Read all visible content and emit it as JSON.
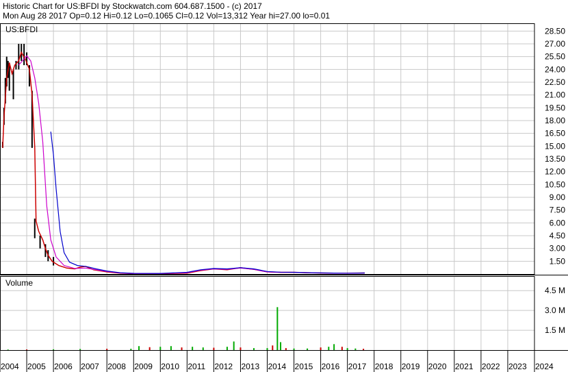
{
  "header": {
    "line1": "Historic Chart for US:BFDI by Stockwatch.com 604.687.1500 - (c) 2017",
    "line2": "Mon Aug 28 2017   Op=0.12  Hi=0.12  Lo=0.1065  Cl=0.12  Vol=13,312  Year hi=27.00  lo=0.01"
  },
  "chart_data": {
    "type": "line",
    "symbol_label": "US:BFDI",
    "volume_label": "Volume",
    "x_start_year": 2004.0,
    "x_end_year": 2024.0,
    "x_ticks": [
      "2004",
      "2005",
      "2006",
      "2007",
      "2008",
      "2009",
      "2010",
      "2011",
      "2012",
      "2013",
      "2014",
      "2015",
      "2016",
      "2017",
      "2018",
      "2019",
      "2020",
      "2021",
      "2022",
      "2023",
      "2024"
    ],
    "price_ylim": [
      0,
      29.25
    ],
    "price_ticks": [
      "1.50",
      "3.00",
      "4.50",
      "6.00",
      "7.50",
      "9.00",
      "10.50",
      "12.00",
      "13.50",
      "15.00",
      "16.50",
      "18.00",
      "19.50",
      "21.00",
      "22.50",
      "24.00",
      "25.50",
      "27.00",
      "28.50"
    ],
    "volume_ylim": [
      0,
      5.6
    ],
    "volume_ticks": [
      "1.5 M",
      "3.0 M",
      "4.5 M"
    ],
    "grid": true,
    "colors": {
      "price_hi_lo": "#000000",
      "price_down": "#cc0000",
      "ma_short": "#cc00cc",
      "ma_long": "#0000cc",
      "volume_up": "#00aa00",
      "volume_down": "#cc0000",
      "grid": "#c8c8c8"
    },
    "series": [
      {
        "name": "",
        "kind": "price_close",
        "points": [
          [
            2004.1,
            14.8
          ],
          [
            2004.15,
            18.5
          ],
          [
            2004.25,
            23.0
          ],
          [
            2004.35,
            24.8
          ],
          [
            2004.45,
            23.5
          ],
          [
            2004.55,
            24.5
          ],
          [
            2004.7,
            25.0
          ],
          [
            2004.8,
            26.0
          ],
          [
            2004.95,
            25.2
          ],
          [
            2005.1,
            24.0
          ],
          [
            2005.2,
            21.0
          ],
          [
            2005.3,
            14.8
          ],
          [
            2005.35,
            6.2
          ],
          [
            2005.45,
            5.0
          ],
          [
            2005.6,
            4.0
          ],
          [
            2005.7,
            3.0
          ],
          [
            2005.8,
            2.2
          ],
          [
            2005.95,
            1.5
          ],
          [
            2006.2,
            1.0
          ],
          [
            2006.5,
            0.7
          ],
          [
            2006.8,
            0.6
          ],
          [
            2007.0,
            0.8
          ],
          [
            2007.2,
            0.9
          ],
          [
            2007.5,
            0.5
          ],
          [
            2008.0,
            0.25
          ],
          [
            2008.5,
            0.1
          ],
          [
            2009.0,
            0.05
          ],
          [
            2010.0,
            0.05
          ],
          [
            2011.0,
            0.1
          ],
          [
            2011.5,
            0.4
          ],
          [
            2012.0,
            0.6
          ],
          [
            2012.5,
            0.5
          ],
          [
            2013.0,
            0.75
          ],
          [
            2013.5,
            0.55
          ],
          [
            2014.0,
            0.25
          ],
          [
            2014.5,
            0.2
          ],
          [
            2015.0,
            0.2
          ],
          [
            2015.5,
            0.15
          ],
          [
            2016.0,
            0.12
          ],
          [
            2016.5,
            0.1
          ],
          [
            2017.0,
            0.1
          ],
          [
            2017.65,
            0.12
          ]
        ]
      },
      {
        "name": "",
        "kind": "moving_average_short",
        "points": [
          [
            2004.7,
            24.5
          ],
          [
            2005.0,
            25.6
          ],
          [
            2005.15,
            25.0
          ],
          [
            2005.3,
            23.0
          ],
          [
            2005.45,
            20.0
          ],
          [
            2005.6,
            15.5
          ],
          [
            2005.75,
            8.0
          ],
          [
            2005.9,
            4.0
          ],
          [
            2006.1,
            2.0
          ],
          [
            2006.4,
            1.0
          ],
          [
            2006.8,
            0.65
          ],
          [
            2007.2,
            0.7
          ],
          [
            2007.6,
            0.5
          ],
          [
            2008.0,
            0.3
          ],
          [
            2008.5,
            0.12
          ],
          [
            2009.0,
            0.06
          ],
          [
            2010.0,
            0.06
          ],
          [
            2011.0,
            0.15
          ],
          [
            2011.5,
            0.45
          ],
          [
            2012.0,
            0.6
          ],
          [
            2012.5,
            0.55
          ],
          [
            2013.0,
            0.7
          ],
          [
            2013.5,
            0.55
          ],
          [
            2014.0,
            0.25
          ],
          [
            2014.5,
            0.2
          ],
          [
            2015.0,
            0.2
          ],
          [
            2015.5,
            0.15
          ],
          [
            2016.0,
            0.12
          ],
          [
            2016.5,
            0.1
          ],
          [
            2017.0,
            0.1
          ],
          [
            2017.65,
            0.12
          ]
        ]
      },
      {
        "name": "",
        "kind": "moving_average_long",
        "points": [
          [
            2005.9,
            16.7
          ],
          [
            2006.0,
            14.0
          ],
          [
            2006.1,
            10.0
          ],
          [
            2006.25,
            5.0
          ],
          [
            2006.4,
            2.5
          ],
          [
            2006.6,
            1.4
          ],
          [
            2006.9,
            1.0
          ],
          [
            2007.2,
            0.9
          ],
          [
            2007.6,
            0.6
          ],
          [
            2008.0,
            0.35
          ],
          [
            2008.5,
            0.15
          ],
          [
            2009.0,
            0.08
          ],
          [
            2010.0,
            0.07
          ],
          [
            2011.0,
            0.2
          ],
          [
            2011.5,
            0.5
          ],
          [
            2012.0,
            0.65
          ],
          [
            2012.5,
            0.6
          ],
          [
            2013.0,
            0.75
          ],
          [
            2013.5,
            0.6
          ],
          [
            2014.0,
            0.3
          ],
          [
            2014.5,
            0.22
          ],
          [
            2015.0,
            0.2
          ],
          [
            2015.5,
            0.16
          ],
          [
            2016.0,
            0.13
          ],
          [
            2016.5,
            0.11
          ],
          [
            2017.0,
            0.1
          ],
          [
            2017.65,
            0.12
          ]
        ]
      }
    ],
    "price_bars": [
      [
        2004.1,
        14.8,
        15.5
      ],
      [
        2004.15,
        17.5,
        19.5
      ],
      [
        2004.2,
        20.0,
        23.0
      ],
      [
        2004.25,
        22.0,
        25.5
      ],
      [
        2004.3,
        23.0,
        25.0
      ],
      [
        2004.35,
        21.5,
        24.5
      ],
      [
        2004.5,
        20.5,
        24.0
      ],
      [
        2004.6,
        24.0,
        25.0
      ],
      [
        2004.7,
        24.0,
        27.0
      ],
      [
        2004.8,
        25.0,
        27.0
      ],
      [
        2004.9,
        24.5,
        27.0
      ],
      [
        2005.0,
        24.5,
        26.0
      ],
      [
        2005.1,
        22.0,
        24.5
      ],
      [
        2005.2,
        14.8,
        21.5
      ],
      [
        2005.3,
        4.2,
        6.5
      ],
      [
        2005.5,
        3.0,
        4.5
      ],
      [
        2005.7,
        2.0,
        3.5
      ],
      [
        2005.8,
        1.5,
        2.8
      ],
      [
        2006.0,
        1.0,
        2.0
      ]
    ],
    "volume": [
      [
        2004.3,
        0.04
      ],
      [
        2005.0,
        0.05
      ],
      [
        2006.0,
        0.06
      ],
      [
        2007.0,
        0.08
      ],
      [
        2008.0,
        0.1
      ],
      [
        2008.9,
        0.1
      ],
      [
        2009.2,
        0.3
      ],
      [
        2009.6,
        0.22
      ],
      [
        2010.0,
        0.25
      ],
      [
        2010.4,
        0.3
      ],
      [
        2010.8,
        0.2
      ],
      [
        2011.2,
        0.25
      ],
      [
        2011.6,
        0.2
      ],
      [
        2012.0,
        0.18
      ],
      [
        2012.5,
        0.25
      ],
      [
        2012.75,
        0.65
      ],
      [
        2013.0,
        0.2
      ],
      [
        2013.5,
        0.15
      ],
      [
        2014.0,
        0.15
      ],
      [
        2014.2,
        0.35
      ],
      [
        2014.38,
        3.25
      ],
      [
        2014.5,
        0.6
      ],
      [
        2014.7,
        0.15
      ],
      [
        2015.0,
        0.12
      ],
      [
        2015.5,
        0.12
      ],
      [
        2016.0,
        0.2
      ],
      [
        2016.3,
        0.25
      ],
      [
        2016.5,
        0.45
      ],
      [
        2016.8,
        0.25
      ],
      [
        2017.0,
        0.15
      ],
      [
        2017.3,
        0.12
      ],
      [
        2017.6,
        0.1
      ]
    ]
  }
}
